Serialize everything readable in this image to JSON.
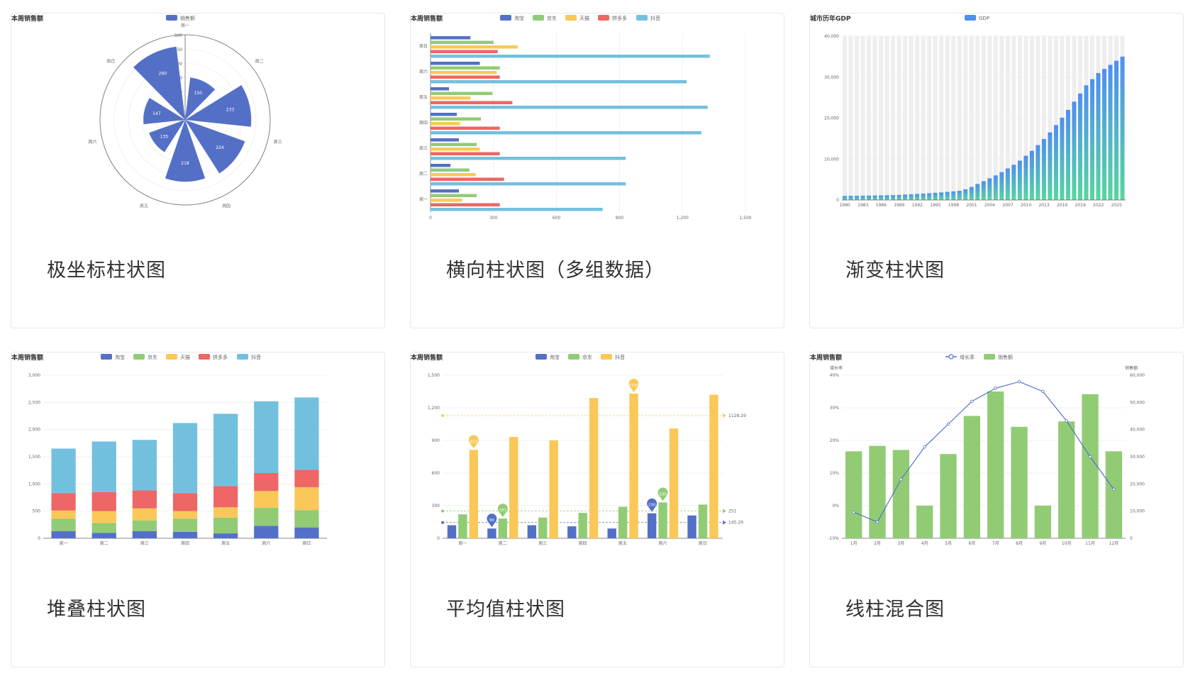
{
  "cards": [
    {
      "caption": "极坐标柱状图"
    },
    {
      "caption": "横向柱状图（多组数据）"
    },
    {
      "caption": "渐变柱状图"
    },
    {
      "caption": "堆叠柱状图"
    },
    {
      "caption": "平均值柱状图"
    },
    {
      "caption": "线柱混合图"
    }
  ],
  "colors": {
    "blue": "#5470c6",
    "green": "#91cc75",
    "yellow": "#fac858",
    "red": "#ee6666",
    "cyan": "#73c0de",
    "grad_top": "#4f8ff0",
    "grad_bottom": "#56d6a0",
    "bg_bar": "#eeeeee"
  },
  "chart_data": [
    {
      "type": "bar",
      "subtype": "polar",
      "title": "本周销售额",
      "legend": [
        "销售额"
      ],
      "categories": [
        "周一",
        "周二",
        "周三",
        "周四",
        "周五",
        "周六",
        "周日"
      ],
      "values": [
        150,
        233,
        224,
        218,
        135,
        147,
        260
      ],
      "radius_ticks": [
        0,
        50,
        100,
        150,
        200,
        250,
        300
      ],
      "rmax": 300
    },
    {
      "type": "bar",
      "subtype": "horizontal",
      "title": "本周销售额",
      "legend": [
        "淘宝",
        "京东",
        "天猫",
        "拼多多",
        "抖音"
      ],
      "categories": [
        "周一",
        "周二",
        "周三",
        "周四",
        "周五",
        "周六",
        "周日"
      ],
      "series": [
        {
          "name": "淘宝",
          "values": [
            135,
            95,
            135,
            125,
            88,
            235,
            190
          ]
        },
        {
          "name": "京东",
          "values": [
            220,
            185,
            220,
            240,
            295,
            330,
            300
          ]
        },
        {
          "name": "天猫",
          "values": [
            150,
            215,
            235,
            140,
            190,
            315,
            415
          ]
        },
        {
          "name": "拼多多",
          "values": [
            330,
            350,
            330,
            330,
            390,
            330,
            320
          ]
        },
        {
          "name": "抖音",
          "values": [
            820,
            930,
            930,
            1290,
            1320,
            1220,
            1330
          ]
        }
      ],
      "xticks": [
        "0",
        "300",
        "600",
        "900",
        "1,200",
        "1,500"
      ],
      "xlim": [
        0,
        1500
      ]
    },
    {
      "type": "bar",
      "subtype": "gradient",
      "title": "城市历年GDP",
      "legend": [
        "GDP"
      ],
      "start_year": 1980,
      "end_year": 2026,
      "xticks": [
        "1980",
        "1983",
        "1986",
        "1989",
        "1992",
        "1995",
        "1998",
        "2001",
        "2004",
        "2007",
        "2010",
        "2013",
        "2016",
        "2019",
        "2022",
        "2025"
      ],
      "values": [
        1000,
        1020,
        1040,
        1060,
        1080,
        1100,
        1130,
        1160,
        1200,
        1250,
        1320,
        1400,
        1480,
        1560,
        1650,
        1750,
        1860,
        1980,
        2100,
        2250,
        2600,
        3200,
        3900,
        4600,
        5300,
        6000,
        6800,
        7700,
        8600,
        9600,
        10800,
        12000,
        13400,
        14900,
        16500,
        18300,
        20100,
        22000,
        24000,
        26000,
        28000,
        29500,
        31000,
        32000,
        33000,
        34000,
        35000
      ],
      "yticks": [
        "0",
        "10,000",
        "20,000",
        "30,000",
        "40,000"
      ],
      "ylim": [
        0,
        40000
      ]
    },
    {
      "type": "bar",
      "subtype": "stacked",
      "title": "本周销售额",
      "legend": [
        "淘宝",
        "京东",
        "天猫",
        "拼多多",
        "抖音"
      ],
      "categories": [
        "周一",
        "周二",
        "周三",
        "周四",
        "周五",
        "周六",
        "周日"
      ],
      "series": [
        {
          "name": "淘宝",
          "values": [
            130,
            100,
            130,
            120,
            90,
            230,
            200
          ]
        },
        {
          "name": "京东",
          "values": [
            230,
            180,
            200,
            240,
            290,
            330,
            320
          ]
        },
        {
          "name": "天猫",
          "values": [
            150,
            220,
            220,
            140,
            190,
            310,
            420
          ]
        },
        {
          "name": "拼多多",
          "values": [
            320,
            350,
            330,
            330,
            390,
            330,
            320
          ]
        },
        {
          "name": "抖音",
          "values": [
            820,
            930,
            930,
            1290,
            1330,
            1320,
            1330
          ]
        }
      ],
      "yticks": [
        "0",
        "500",
        "1,000",
        "1,500",
        "2,000",
        "2,500",
        "3,000"
      ],
      "ylim": [
        0,
        3000
      ]
    },
    {
      "type": "bar",
      "subtype": "average",
      "title": "本周销售额",
      "legend": [
        "淘宝",
        "京东",
        "抖音"
      ],
      "categories": [
        "周一",
        "周二",
        "周三",
        "周四",
        "周五",
        "周六",
        "周日"
      ],
      "series": [
        {
          "name": "淘宝",
          "values": [
            120,
            90,
            120,
            110,
            90,
            230,
            210
          ]
        },
        {
          "name": "京东",
          "values": [
            220,
            182,
            191,
            234,
            290,
            330,
            310
          ]
        },
        {
          "name": "抖音",
          "values": [
            813,
            932,
            901,
            1290,
            1330,
            1010,
            1320
          ]
        }
      ],
      "max_labels": {
        "淘宝": "230",
        "京东": "330",
        "抖音": "1330"
      },
      "min_labels": {
        "淘宝": "90",
        "京东": "182",
        "抖音": "813"
      },
      "average_labels": {
        "淘宝": "145.29",
        "京东": "251",
        "抖音": "1128.29"
      },
      "averages": [
        145.29,
        251,
        1128.29
      ],
      "yticks": [
        "0",
        "300",
        "600",
        "900",
        "1,200",
        "1,500"
      ],
      "ylim": [
        0,
        1500
      ]
    },
    {
      "type": "bar",
      "subtype": "line-bar",
      "title": "本周销售额",
      "legend": [
        "增长率",
        "销售额"
      ],
      "left_axis_name": "增长率",
      "right_axis_name": "销售额",
      "categories": [
        "1月",
        "2月",
        "3月",
        "4月",
        "5月",
        "6月",
        "7月",
        "8月",
        "9月",
        "10月",
        "11月",
        "12月"
      ],
      "bar_values": [
        32000,
        34000,
        32500,
        12000,
        31000,
        45000,
        54000,
        41000,
        12000,
        43000,
        53000,
        32000
      ],
      "line_values": [
        -2,
        -5,
        8,
        18,
        25,
        32,
        36,
        38,
        35,
        26,
        15,
        5
      ],
      "left_ticks": [
        "-10%",
        "0%",
        "10%",
        "20%",
        "30%",
        "40%"
      ],
      "right_ticks": [
        "0",
        "10,000",
        "20,000",
        "30,000",
        "40,000",
        "50,000",
        "60,000"
      ],
      "left_lim": [
        -10,
        40
      ],
      "right_lim": [
        0,
        60000
      ]
    }
  ]
}
